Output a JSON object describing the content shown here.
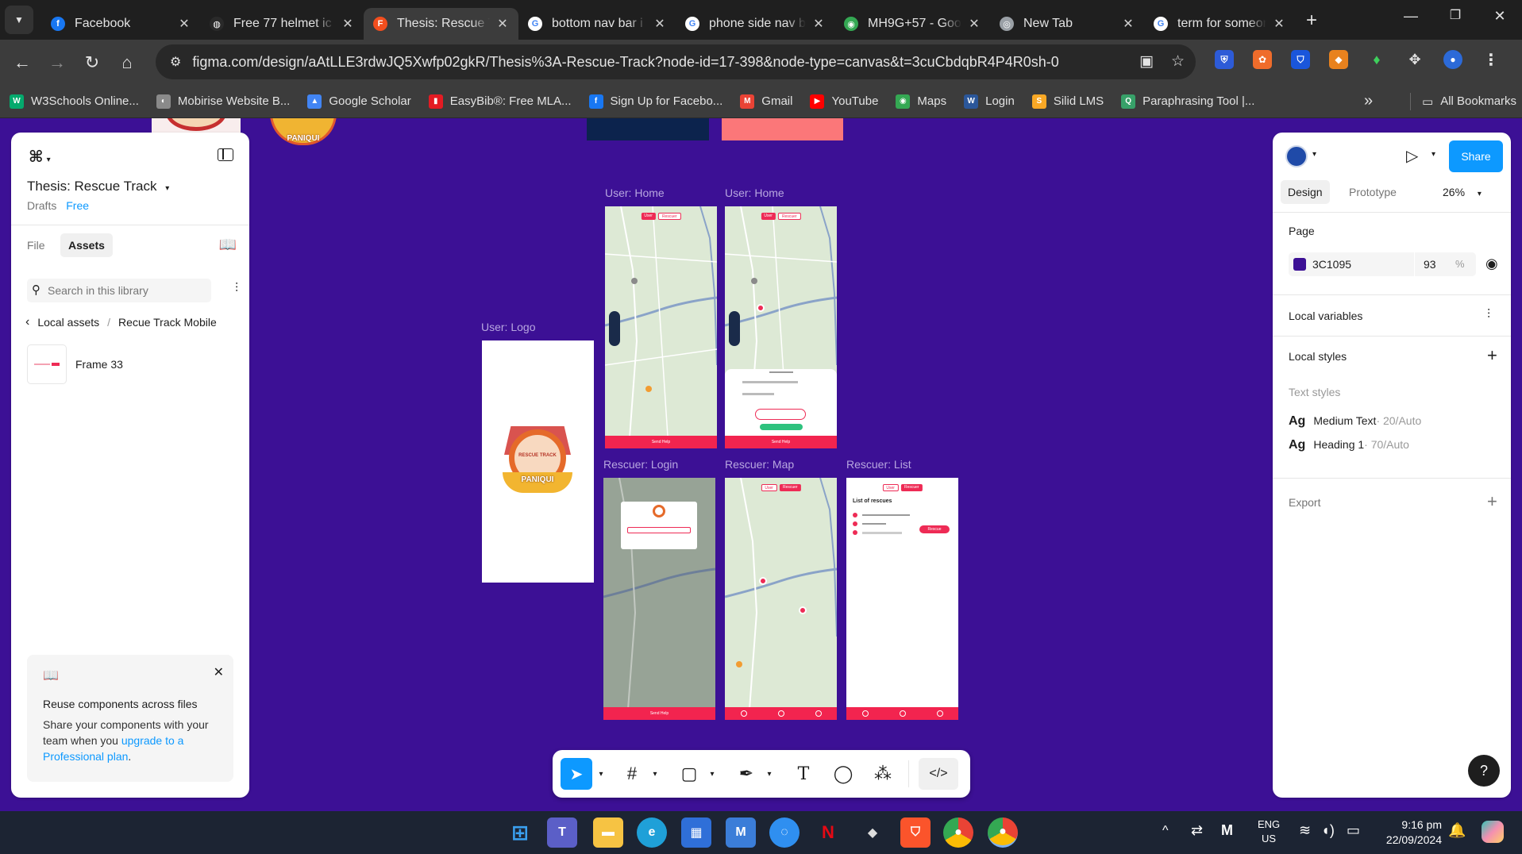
{
  "browser": {
    "tabs": [
      {
        "title": "Facebook",
        "icon": "facebook-icon",
        "color": "#1877f2",
        "glyph": "f",
        "active": false
      },
      {
        "title": "Free 77 helmet ic",
        "icon": "helmet-site-icon",
        "color": "#2a2a2a",
        "glyph": "◍",
        "active": false
      },
      {
        "title": "Thesis: Rescue Tr",
        "icon": "figma-icon",
        "color": "#f24e1e",
        "glyph": "F",
        "active": true
      },
      {
        "title": "bottom nav bar i",
        "icon": "google-icon",
        "color": "#ffffff",
        "glyph": "G",
        "active": false
      },
      {
        "title": "phone side nav b",
        "icon": "google-icon",
        "color": "#ffffff",
        "glyph": "G",
        "active": false
      },
      {
        "title": "MH9G+57 - Goo",
        "icon": "google-maps-icon",
        "color": "#34a853",
        "glyph": "◉",
        "active": false
      },
      {
        "title": "New Tab",
        "icon": "chrome-icon",
        "color": "#9aa0a6",
        "glyph": "◎",
        "active": false
      },
      {
        "title": "term for someon",
        "icon": "google-icon",
        "color": "#ffffff",
        "glyph": "G",
        "active": false
      }
    ],
    "new_tab": "+",
    "url": "figma.com/design/aAtLLE3rdwJQ5Xwfp02gkR/Thesis%3A-Rescue-Track?node-id=17-398&node-type=canvas&t=3cuCbdqbR4P4R0sh-0",
    "bookmarks": [
      {
        "label": "W3Schools Online...",
        "color": "#04aa6d",
        "glyph": "W"
      },
      {
        "label": "Mobirise Website B...",
        "color": "#8a8a8a",
        "glyph": "◐"
      },
      {
        "label": "Google Scholar",
        "color": "#4285f4",
        "glyph": "▲"
      },
      {
        "label": "EasyBib®: Free MLA...",
        "color": "#e41b23",
        "glyph": "▮"
      },
      {
        "label": "Sign Up for Facebo...",
        "color": "#1877f2",
        "glyph": "f"
      },
      {
        "label": "Gmail",
        "color": "#ea4335",
        "glyph": "M"
      },
      {
        "label": "YouTube",
        "color": "#ff0000",
        "glyph": "▶"
      },
      {
        "label": "Maps",
        "color": "#34a853",
        "glyph": "◉"
      },
      {
        "label": "Login",
        "color": "#2b579a",
        "glyph": "W"
      },
      {
        "label": "Silid LMS",
        "color": "#f9a825",
        "glyph": "S"
      },
      {
        "label": "Paraphrasing Tool |...",
        "color": "#37a169",
        "glyph": "Q"
      }
    ],
    "all_bookmarks": "All Bookmarks",
    "more": "»"
  },
  "left_panel": {
    "file_title": "Thesis: Rescue Track",
    "drafts": "Drafts",
    "plan_badge": "Free",
    "tab_file": "File",
    "tab_assets": "Assets",
    "search_placeholder": "Search in this library",
    "breadcrumb_root": "Local assets",
    "breadcrumb_sep": "/",
    "breadcrumb_current": "Recue Track Mobile",
    "asset_item": "Frame 33",
    "promo_title": "Reuse components across files",
    "promo_text": "Share your components with your team when you ",
    "promo_link": "upgrade to a Professional plan",
    "promo_end": "."
  },
  "right_panel": {
    "share": "Share",
    "tab_design": "Design",
    "tab_prototype": "Prototype",
    "zoom": "26%",
    "page_section": "Page",
    "page_color_hex": "3C1095",
    "page_color": "#3c1095",
    "page_opacity": "93",
    "percent": "%",
    "local_variables": "Local variables",
    "local_styles": "Local styles",
    "text_styles": "Text styles",
    "styles": [
      {
        "ag": "Ag",
        "name": "Medium Text",
        "meta": " · 20/Auto"
      },
      {
        "ag": "Ag",
        "name": "Heading 1",
        "meta": " · 70/Auto"
      }
    ],
    "export": "Export",
    "help": "?"
  },
  "canvas": {
    "frames": {
      "user_logo": "User: Logo",
      "user_home_1": "User: Home",
      "user_home_2": "User: Home",
      "rescuer_login": "Rescuer: Login",
      "rescuer_map": "Rescuer: Map",
      "rescuer_list": "Rescuer: List"
    },
    "logo_text": "PANIQUI",
    "logo_ring_text": "RESCUE TRACK",
    "list_title": "List of rescues",
    "rescue_btn": "Rescue",
    "user_tab": "User",
    "rescuer_tab": "Rescuer",
    "send_help": "Send Help"
  },
  "taskbar": {
    "lang": "ENG",
    "region": "US",
    "time": "9:16 pm",
    "date": "22/09/2024"
  }
}
